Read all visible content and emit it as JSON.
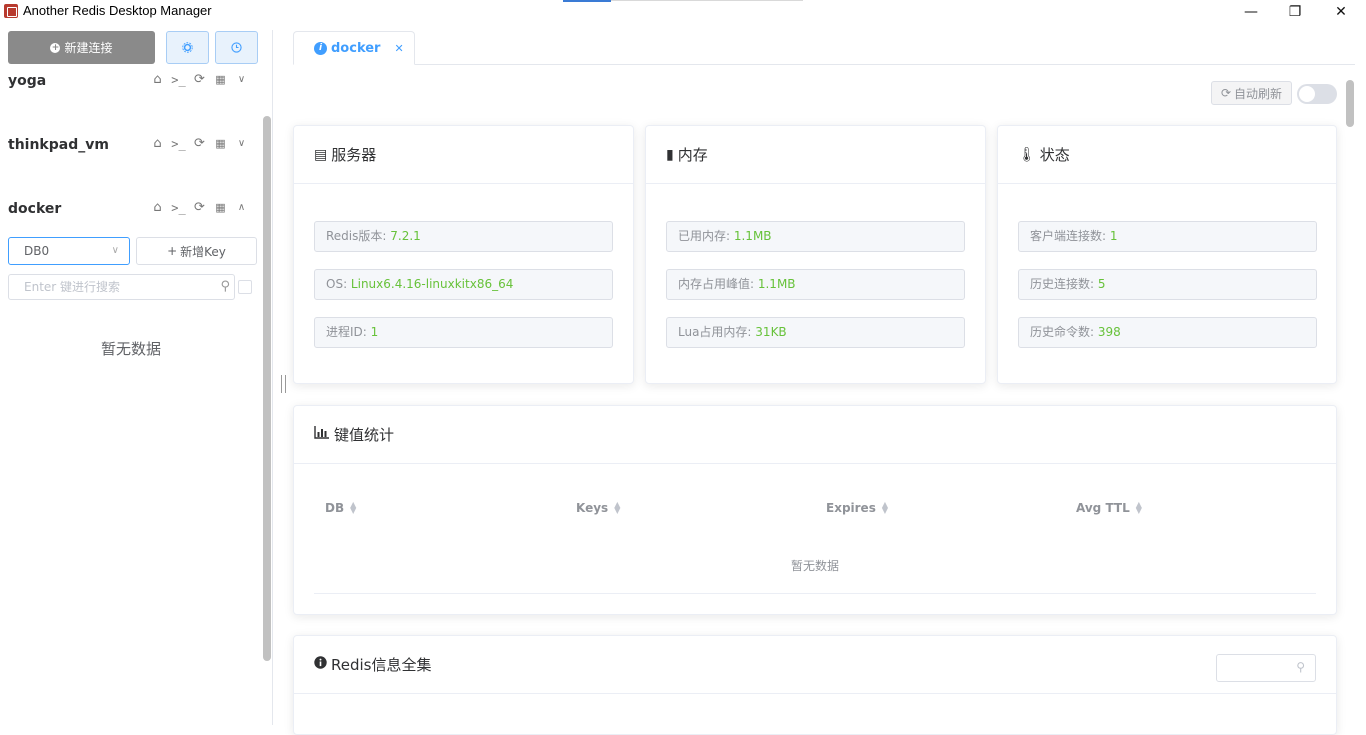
{
  "window": {
    "title": "Another Redis Desktop Manager",
    "minimize_glyph": "—",
    "maximize_glyph": "❐",
    "close_glyph": "✕"
  },
  "aside": {
    "new_connection_label": "新建连接",
    "settings_icon": "settings-icon",
    "history_icon": "clock-icon",
    "connections": [
      {
        "name": "yoga",
        "expanded": false
      },
      {
        "name": "thinkpad_vm",
        "expanded": false
      },
      {
        "name": "docker",
        "expanded": true
      }
    ],
    "op_icons": [
      "home-icon",
      "terminal-icon",
      "refresh-icon",
      "grid-icon"
    ],
    "db_select_value": "DB0",
    "new_key_label": "新增Key",
    "search_placeholder": "Enter 键进行搜索",
    "empty_text": "暂无数据"
  },
  "main": {
    "tab_label": "docker",
    "auto_refresh_label": "自动刷新",
    "auto_refresh_on": false,
    "server": {
      "title": "服务器",
      "fields": [
        {
          "label": "Redis版本: ",
          "value": "7.2.1"
        },
        {
          "label": "OS: ",
          "value": "Linux6.4.16-linuxkitx86_64"
        },
        {
          "label": "进程ID: ",
          "value": "1"
        }
      ]
    },
    "memory": {
      "title": "内存",
      "fields": [
        {
          "label": "已用内存: ",
          "value": "1.1MB"
        },
        {
          "label": "内存占用峰值: ",
          "value": "1.1MB"
        },
        {
          "label": "Lua占用内存: ",
          "value": "31KB"
        }
      ]
    },
    "status": {
      "title": "状态",
      "fields": [
        {
          "label": "客户端连接数: ",
          "value": "1"
        },
        {
          "label": "历史连接数: ",
          "value": "5"
        },
        {
          "label": "历史命令数: ",
          "value": "398"
        }
      ]
    },
    "keys_stats": {
      "title": "键值统计",
      "columns": [
        "DB",
        "Keys",
        "Expires",
        "Avg TTL"
      ],
      "empty_text": "暂无数据"
    },
    "redis_info": {
      "title": "Redis信息全集"
    },
    "colors": {
      "accent": "#409eff",
      "value_green": "#67c23a"
    }
  }
}
